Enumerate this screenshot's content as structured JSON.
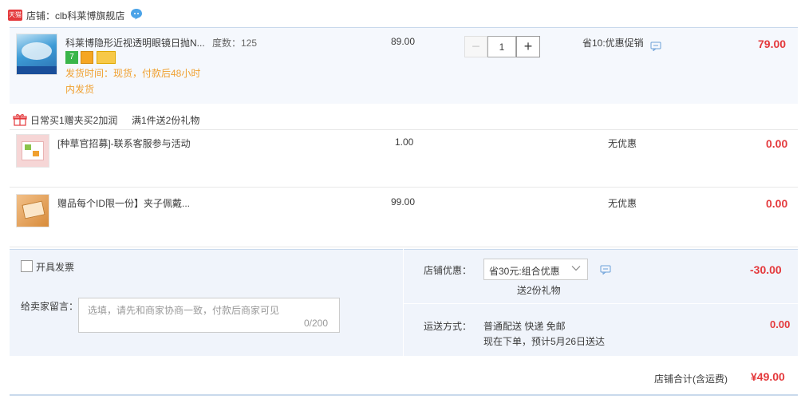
{
  "shop": {
    "badge": "天猫",
    "label": "店铺：clb科莱博旗舰店"
  },
  "main_item": {
    "title": "科莱博隐形近视透明眼镜日抛N...",
    "spec": "度数：125",
    "tags": [
      "7",
      "",
      ""
    ],
    "ship_time": "发货时间：现货，付款后48小时内发货",
    "price": "89.00",
    "quantity": "1",
    "promo": "省10:优惠促销",
    "subtotal": "79.00"
  },
  "gift_header": {
    "text1": "日常买1赠夹买2加润",
    "text2": "满1件送2份礼物"
  },
  "gift_items": [
    {
      "title": "[种草官招募]-联系客服参与活动",
      "price": "1.00",
      "promo": "无优惠",
      "subtotal": "0.00"
    },
    {
      "title": "赠品每个ID限一份】夹子佩戴...",
      "price": "99.00",
      "promo": "无优惠",
      "subtotal": "0.00"
    }
  ],
  "invoice": {
    "label": "开具发票"
  },
  "message": {
    "label": "给卖家留言：",
    "placeholder": "选填，请先和商家协商一致，付款后商家可见",
    "count": "0/200"
  },
  "discount": {
    "label": "店铺优惠：",
    "selected": "省30元:组合优惠",
    "gift_note": "送2份礼物",
    "amount": "-30.00"
  },
  "shipping": {
    "label": "运送方式：",
    "method": "普通配送 快递 免邮",
    "eta": "现在下单，预计5月26日送达",
    "fee": "0.00"
  },
  "total": {
    "label": "店铺合计(含运费)",
    "amount": "¥49.00"
  },
  "colors": {
    "accent_red": "#e4393c",
    "ship_orange": "#f0a030",
    "panel_blue": "#f0f4fb"
  }
}
